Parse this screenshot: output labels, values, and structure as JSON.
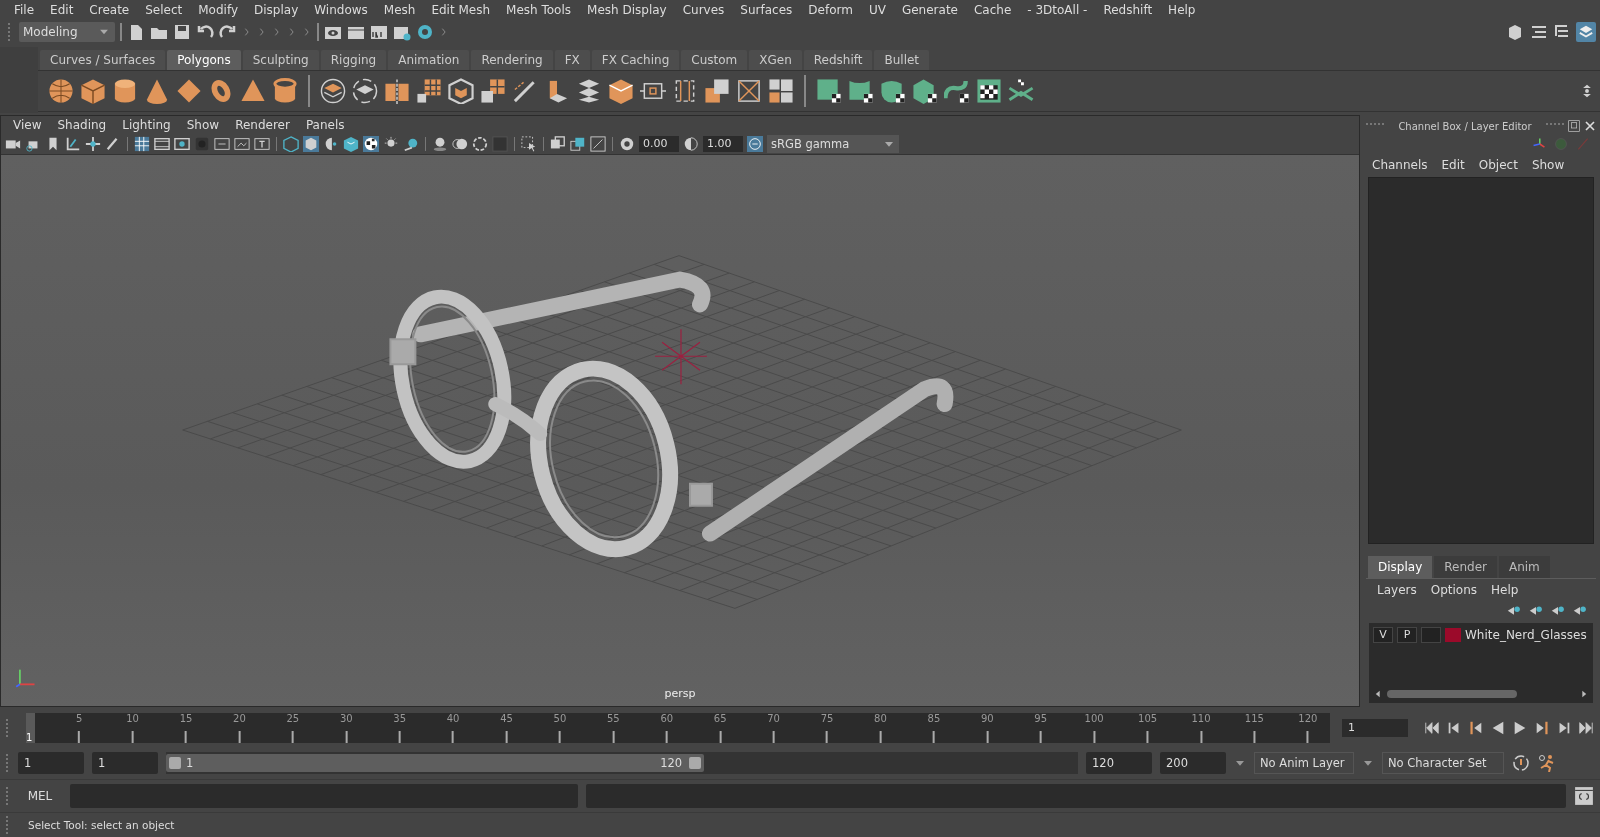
{
  "menu_bar": [
    "File",
    "Edit",
    "Create",
    "Select",
    "Modify",
    "Display",
    "Windows",
    "Mesh",
    "Edit Mesh",
    "Mesh Tools",
    "Mesh Display",
    "Curves",
    "Surfaces",
    "Deform",
    "UV",
    "Generate",
    "Cache",
    "- 3DtoAll -",
    "Redshift",
    "Help"
  ],
  "workspace": {
    "value": "Modeling"
  },
  "shelf_tabs": [
    {
      "label": "Curves / Surfaces",
      "selected": false
    },
    {
      "label": "Polygons",
      "selected": true
    },
    {
      "label": "Sculpting",
      "selected": false
    },
    {
      "label": "Rigging",
      "selected": false
    },
    {
      "label": "Animation",
      "selected": false
    },
    {
      "label": "Rendering",
      "selected": false
    },
    {
      "label": "FX",
      "selected": false
    },
    {
      "label": "FX Caching",
      "selected": false
    },
    {
      "label": "Custom",
      "selected": false
    },
    {
      "label": "XGen",
      "selected": false
    },
    {
      "label": "Redshift",
      "selected": false
    },
    {
      "label": "Bullet",
      "selected": false
    }
  ],
  "panel_menu": [
    "View",
    "Shading",
    "Lighting",
    "Show",
    "Renderer",
    "Panels"
  ],
  "viewport_toolbar": {
    "exposure": "0.00",
    "gamma": "1.00",
    "color_space": "sRGB gamma"
  },
  "viewport": {
    "camera_label": "persp"
  },
  "channel_box": {
    "title": "Channel Box / Layer Editor",
    "menu": [
      "Channels",
      "Edit",
      "Object",
      "Show"
    ]
  },
  "layer_editor": {
    "tabs": [
      {
        "label": "Display",
        "selected": true
      },
      {
        "label": "Render",
        "selected": false
      },
      {
        "label": "Anim",
        "selected": false
      }
    ],
    "menu": [
      "Layers",
      "Options",
      "Help"
    ],
    "layers": [
      {
        "visible": "V",
        "playback": "P",
        "name": "White_Nerd_Glasses",
        "color": "#9b0a2a"
      }
    ]
  },
  "timeline": {
    "level": 0,
    "current_frame": "1",
    "ticks": [
      "5",
      "10",
      "15",
      "20",
      "25",
      "30",
      "35",
      "40",
      "45",
      "50",
      "55",
      "60",
      "65",
      "70",
      "75",
      "80",
      "85",
      "90",
      "95",
      "100",
      "105",
      "110",
      "115",
      "120"
    ],
    "current_frame_field": "1"
  },
  "range": {
    "level": 0.59,
    "start": "1",
    "playback_start": "1",
    "slider_start": "1",
    "slider_end": "120",
    "playback_end": "120",
    "end": "200",
    "anim_layer": "No Anim Layer",
    "character_set": "No Character Set"
  },
  "command_line": {
    "language": "MEL"
  },
  "status_bar": {
    "message": "Select Tool: select an object"
  }
}
